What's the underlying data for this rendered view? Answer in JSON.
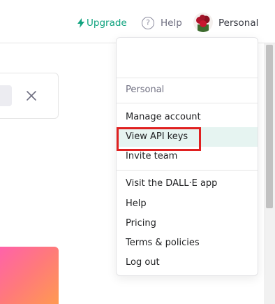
{
  "header": {
    "upgrade_label": "Upgrade",
    "help_label": "Help",
    "help_symbol": "?",
    "account_label": "Personal"
  },
  "menu": {
    "section_header": "Personal",
    "items": [
      {
        "label": "Manage account"
      },
      {
        "label": "View API keys",
        "highlighted": true
      },
      {
        "label": "Invite team"
      },
      {
        "label": "Visit the DALL·E app"
      },
      {
        "label": "Help"
      },
      {
        "label": "Pricing"
      },
      {
        "label": "Terms & policies"
      },
      {
        "label": "Log out"
      }
    ]
  },
  "colors": {
    "accent": "#10a37f",
    "highlight_bg": "#e6f4f1",
    "annotation_red": "#e02020"
  },
  "icons": {
    "upgrade": "lightning-bolt-icon",
    "help": "question-circle-icon",
    "close": "close-icon",
    "avatar": "rose-avatar"
  }
}
